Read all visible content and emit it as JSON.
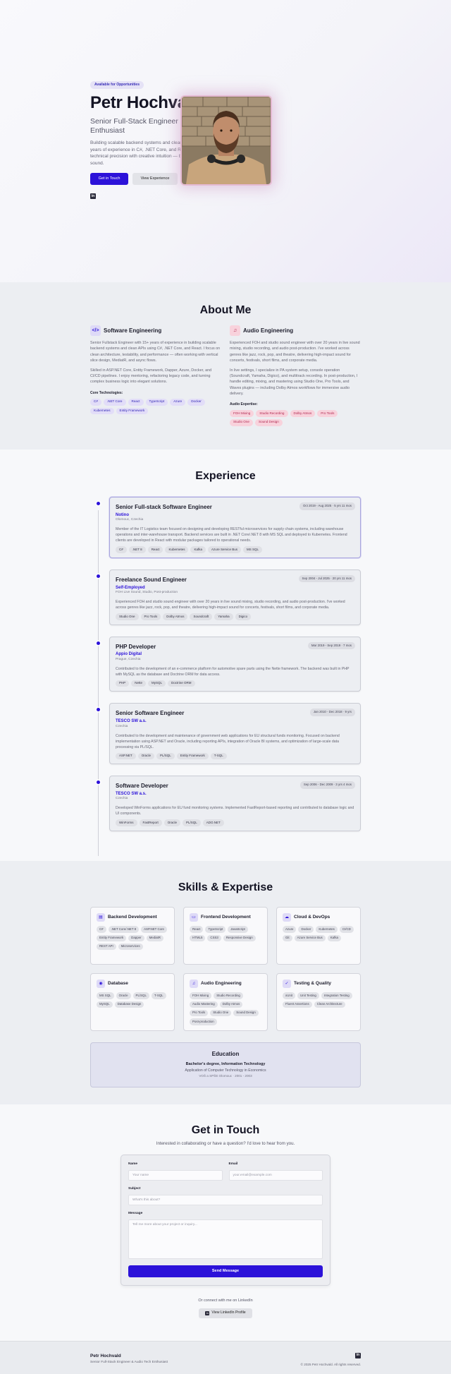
{
  "hero": {
    "badge": "Available for Opportunities",
    "name": "Petr Hochvald",
    "role": "Senior Full-Stack Engineer & Audio Tech Enthusiast",
    "description": "Building scalable backend systems and clean APIs with 15+ years of experience in C#, .NET Core, and React. Blending technical precision with creative intuition — both in code and sound.",
    "cta_primary": "Get in Touch",
    "cta_secondary": "View Experience",
    "linkedin_icon": "in"
  },
  "about": {
    "title": "About Me",
    "software": {
      "icon": "code-icon",
      "title": "Software Engineering",
      "p1": "Senior Fullstack Engineer with 15+ years of experience in building scalable backend systems and clean APIs using C#, .NET Core, and React. I focus on clean architecture, testability, and performance — often working with vertical slice design, MediatR, and async flows.",
      "p2": "Skilled in ASP.NET Core, Entity Framework, Dapper, Azure, Docker, and CI/CD pipelines. I enjoy mentoring, refactoring legacy code, and turning complex business logic into elegant solutions.",
      "tech_label": "Core Technologies:",
      "tech": [
        "C#",
        ".NET Core",
        "React",
        "TypeScript",
        "Azure",
        "Docker",
        "Kubernetes",
        "Entity Framework"
      ]
    },
    "audio": {
      "icon": "music-note-icon",
      "title": "Audio Engineering",
      "p1": "Experienced FOH and studio sound engineer with over 20 years in live sound mixing, studio recording, and audio post-production. I've worked across genres like jazz, rock, pop, and theatre, delivering high-impact sound for concerts, festivals, short films, and corporate media.",
      "p2": "In live settings, I specialize in PA system setup, console operation (Soundcraft, Yamaha, Digico), and multitrack recording. In post-production, I handle editing, mixing, and mastering using Studio One, Pro Tools, and Waves plugins — including Dolby Atmos workflows for immersive audio delivery.",
      "tech_label": "Audio Expertise:",
      "tech": [
        "FOH Mixing",
        "Studio Recording",
        "Dolby Atmos",
        "Pro Tools",
        "Studio One",
        "Sound Design"
      ]
    }
  },
  "experience": {
    "title": "Experience",
    "jobs": [
      {
        "title": "Senior Full-stack Software Engineer",
        "company": "Notino",
        "location": "Olomouc, Czechia",
        "date": "Oct 2019 - Aug 2025 · 5 yrs 11 mos",
        "desc": "Member of the IT Logistics team focused on designing and developing RESTful microservices for supply chain systems, including warehouse operations and inter-warehouse transport. Backend services are built in .NET Core/.NET 8 with MS SQL and deployed to Kubernetes. Frontend clients are developed in React with modular packages tailored to operational needs.",
        "tags": [
          "C#",
          ".NET 8",
          "React",
          "Kubernetes",
          "Kafka",
          "Azure Service Bus",
          "MS SQL"
        ]
      },
      {
        "title": "Freelance Sound Engineer",
        "company": "Self-Employed",
        "location": "FOH Live Sound, Studio, Post-production",
        "date": "Sep 2004 - Jul 2025 · 20 yrs 11 mos",
        "desc": "Experienced FOH and studio sound engineer with over 20 years in live sound mixing, studio recording, and audio post-production. I've worked across genres like jazz, rock, pop, and theatre, delivering high-impact sound for concerts, festivals, short films, and corporate media.",
        "tags": [
          "Studio One",
          "Pro Tools",
          "Dolby Atmos",
          "Soundcraft",
          "Yamaha",
          "Digico"
        ]
      },
      {
        "title": "PHP Developer",
        "company": "Appio Digital",
        "location": "Prague, Czechia",
        "date": "Mar 2019 - Sep 2019 · 7 mos",
        "desc": "Contributed to the development of an e-commerce platform for automotive spare parts using the Nette framework. The backend was built in PHP with MySQL as the database and Doctrine ORM for data access.",
        "tags": [
          "PHP",
          "Nette",
          "MySQL",
          "Doctrine ORM"
        ]
      },
      {
        "title": "Senior Software Engineer",
        "company": "TESCO SW a.s.",
        "location": "Czechia",
        "date": "Jan 2010 - Dec 2018 · 9 yrs",
        "desc": "Contributed to the development and maintenance of government web applications for EU structural funds monitoring. Focused on backend implementation using ASP.NET and Oracle, including reporting APIs, integration of Oracle BI systems, and optimization of large-scale data processing via PL/SQL.",
        "tags": [
          "ASP.NET",
          "Oracle",
          "PL/SQL",
          "Entity Framework",
          "T-SQL"
        ]
      },
      {
        "title": "Software Developer",
        "company": "TESCO SW a.s.",
        "location": "Czechia",
        "date": "Sep 2006 - Dec 2009 · 3 yrs 4 mos",
        "desc": "Developed WinForms applications for EU fund monitoring systems. Implemented FastReport-based reporting and contributed to database logic and UI components.",
        "tags": [
          "WinForms",
          "FastReport",
          "Oracle",
          "PL/SQL",
          "ADO.NET"
        ]
      }
    ]
  },
  "skills": {
    "title": "Skills & Expertise",
    "cards": [
      {
        "icon": "server-icon",
        "glyph": "▤",
        "title": "Backend Development",
        "tags": [
          "C#",
          ".NET Core/.NET 8",
          "ASP.NET Core",
          "Entity Framework",
          "Dapper",
          "MediatR",
          "REST API",
          "Microservices"
        ]
      },
      {
        "icon": "monitor-icon",
        "glyph": "▭",
        "title": "Frontend Development",
        "tags": [
          "React",
          "TypeScript",
          "JavaScript",
          "HTML5",
          "CSS3",
          "Responsive Design"
        ]
      },
      {
        "icon": "cloud-icon",
        "glyph": "☁",
        "title": "Cloud & DevOps",
        "tags": [
          "Azure",
          "Docker",
          "Kubernetes",
          "CI/CD",
          "Git",
          "Azure Service Bus",
          "Kafka"
        ]
      },
      {
        "icon": "database-icon",
        "glyph": "◉",
        "title": "Database",
        "tags": [
          "MS SQL",
          "Oracle",
          "PL/SQL",
          "T-SQL",
          "MySQL",
          "Database Design"
        ]
      },
      {
        "icon": "music-note-icon",
        "glyph": "♫",
        "title": "Audio Engineering",
        "tags": [
          "FOH Mixing",
          "Studio Recording",
          "Audio Mastering",
          "Dolby Atmos",
          "Pro Tools",
          "Studio One",
          "Sound Design",
          "Post-production"
        ]
      },
      {
        "icon": "check-circle-icon",
        "glyph": "✓",
        "title": "Testing & Quality",
        "tags": [
          "xUnit",
          "Unit Testing",
          "Integration Testing",
          "Fluent Assertions",
          "Clean Architecture"
        ]
      }
    ],
    "education": {
      "title": "Education",
      "degree": "Bachelor's degree, Information Technology",
      "program": "Application of Computer Technology in Economics",
      "school": "VOŠ a SPŠE Olomouc · 2001 - 2003"
    }
  },
  "contact": {
    "title": "Get in Touch",
    "subtitle": "Interested in collaborating or have a question? I'd love to hear from you.",
    "name_label": "Name",
    "name_placeholder": "Your name",
    "email_label": "Email",
    "email_placeholder": "your.email@example.com",
    "subject_label": "Subject",
    "subject_placeholder": "What's this about?",
    "message_label": "Message",
    "message_placeholder": "Tell me more about your project or inquiry...",
    "send": "Send Message",
    "or_text": "Or connect with me on LinkedIn",
    "linkedin_btn": "View LinkedIn Profile"
  },
  "footer": {
    "name": "Petr Hochvald",
    "sub": "Senior Full-Stack Engineer & Audio Tech Enthusiast",
    "copy": "© 2025 Petr Hochvald. All rights reserved."
  },
  "colors": {
    "accent": "#2c12d9",
    "audio_accent": "#b12850"
  }
}
